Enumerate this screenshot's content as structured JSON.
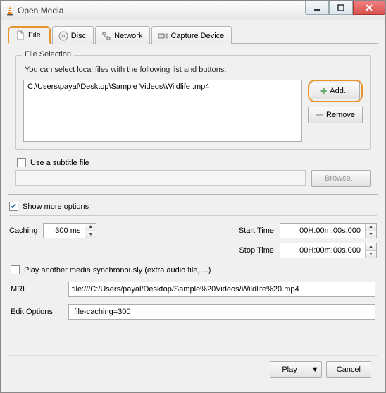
{
  "window": {
    "title": "Open Media"
  },
  "tabs": {
    "file": "File",
    "disc": "Disc",
    "network": "Network",
    "capture": "Capture Device"
  },
  "fileSelection": {
    "legend": "File Selection",
    "hint": "You can select local files with the following list and buttons.",
    "items": [
      "C:\\Users\\payal\\Desktop\\Sample Videos\\Wildlife .mp4"
    ],
    "addLabel": "Add...",
    "removeLabel": "Remove"
  },
  "subtitle": {
    "label": "Use a subtitle file",
    "browse": "Browse..."
  },
  "moreOptions": {
    "label": "Show more options",
    "checked": true
  },
  "options": {
    "cachingLabel": "Caching",
    "cachingValue": "300 ms",
    "startLabel": "Start Time",
    "startValue": "00H:00m:00s.000",
    "stopLabel": "Stop Time",
    "stopValue": "00H:00m:00s.000",
    "playAnother": "Play another media synchronously (extra audio file, ...)",
    "mrlLabel": "MRL",
    "mrlValue": "file:///C:/Users/payal/Desktop/Sample%20Videos/Wildlife%20.mp4",
    "editLabel": "Edit Options",
    "editValue": ":file-caching=300"
  },
  "footer": {
    "play": "Play",
    "cancel": "Cancel"
  },
  "glyphs": {
    "plus": "✚",
    "minus": "—",
    "check": "✔",
    "down": "▼",
    "up": "▲"
  }
}
